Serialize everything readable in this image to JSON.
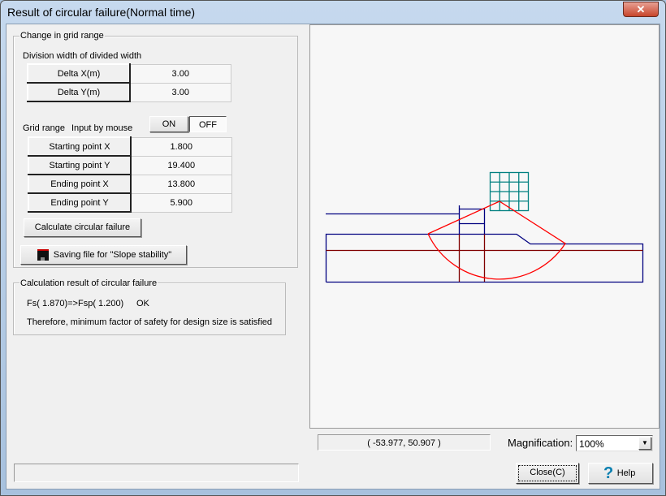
{
  "window": {
    "title": "Result of circular failure(Normal time)",
    "close_glyph": "✕"
  },
  "grid_group": {
    "label": "Change in grid range",
    "division_label": "Division width of divided width",
    "division_rows": [
      {
        "label": "Delta X(m)",
        "value": "3.00"
      },
      {
        "label": "Delta Y(m)",
        "value": "3.00"
      }
    ],
    "grid_range_label": "Grid range",
    "mouse_label": "Input by mouse",
    "on_label": "ON",
    "off_label": "OFF",
    "range_rows": [
      {
        "label": "Starting point X",
        "value": "1.800"
      },
      {
        "label": "Starting point Y",
        "value": "19.400"
      },
      {
        "label": "Ending point X",
        "value": "13.800"
      },
      {
        "label": "Ending point Y",
        "value": "5.900"
      }
    ],
    "calc_button": "Calculate circular failure",
    "save_button": "Saving file for \"Slope stability\""
  },
  "result_group": {
    "label": "Calculation result of circular failure",
    "fs_line": "Fs( 1.870)=>Fsp( 1.200)",
    "status": "OK",
    "message": "Therefore, minimum factor of safety for design size is satisfied"
  },
  "canvas": {
    "coordinates": "( -53.977,   50.907 )",
    "magnification_label": "Magnification:",
    "magnification_value": "100%",
    "colors": {
      "grid": "#008080",
      "structure": "#000080",
      "water": "#800000",
      "circle": "#ff0000"
    }
  },
  "footer": {
    "status_text": "",
    "close_button": "Close(C)",
    "help_button": "Help"
  }
}
